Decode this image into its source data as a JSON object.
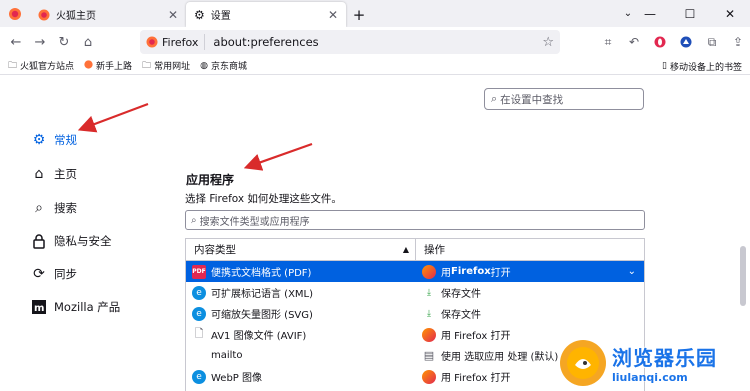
{
  "tabs": [
    {
      "label": "火狐主页",
      "active": false
    },
    {
      "label": "设置",
      "active": true
    }
  ],
  "navbar": {
    "url_brand": "Firefox",
    "url": "about:preferences"
  },
  "bookmarks": {
    "items": [
      "火狐官方站点",
      "新手上路",
      "常用网址",
      "京东商城"
    ],
    "mobile": "移动设备上的书签"
  },
  "settings_search": {
    "placeholder": "在设置中查找"
  },
  "sidebar": {
    "items": [
      {
        "label": "常规",
        "icon": "gear-icon",
        "selected": true
      },
      {
        "label": "主页",
        "icon": "home-icon",
        "selected": false
      },
      {
        "label": "搜索",
        "icon": "search-icon",
        "selected": false
      },
      {
        "label": "隐私与安全",
        "icon": "lock-icon",
        "selected": false
      },
      {
        "label": "同步",
        "icon": "sync-icon",
        "selected": false
      },
      {
        "label": "Mozilla 产品",
        "icon": "mozilla-icon",
        "selected": false
      }
    ]
  },
  "applications": {
    "title": "应用程序",
    "description": "选择 Firefox 如何处理这些文件。",
    "search_placeholder": "搜索文件类型或应用程序",
    "columns": {
      "type": "内容类型",
      "action": "操作"
    },
    "rows": [
      {
        "type": "便携式文档格式 (PDF)",
        "type_icon": "pdf-icon",
        "action_prefix": "用 ",
        "action_bold": "Firefox",
        "action_suffix": " 打开",
        "action_icon": "firefox-icon",
        "selected": true
      },
      {
        "type": "可扩展标记语言 (XML)",
        "type_icon": "edge-icon",
        "action_prefix": "保存文件",
        "action_bold": "",
        "action_suffix": "",
        "action_icon": "save-icon",
        "selected": false
      },
      {
        "type": "可缩放矢量图形 (SVG)",
        "type_icon": "edge-icon",
        "action_prefix": "保存文件",
        "action_bold": "",
        "action_suffix": "",
        "action_icon": "save-icon",
        "selected": false
      },
      {
        "type": "AV1 图像文件 (AVIF)",
        "type_icon": "file-icon",
        "action_prefix": "用 Firefox 打开",
        "action_bold": "",
        "action_suffix": "",
        "action_icon": "firefox-icon",
        "selected": false
      },
      {
        "type": "mailto",
        "type_icon": "none",
        "action_prefix": "使用 选取应用 处理 (默认)",
        "action_bold": "",
        "action_suffix": "",
        "action_icon": "app-icon",
        "selected": false
      },
      {
        "type": "WebP 图像",
        "type_icon": "edge-icon",
        "action_prefix": "用 Firefox 打开",
        "action_bold": "",
        "action_suffix": "",
        "action_icon": "firefox-icon",
        "selected": false
      }
    ]
  },
  "watermark": {
    "title": "浏览器乐园",
    "url": "liulanqi.com"
  },
  "colors": {
    "accent": "#0061e0",
    "arrow": "#d92b2b"
  }
}
